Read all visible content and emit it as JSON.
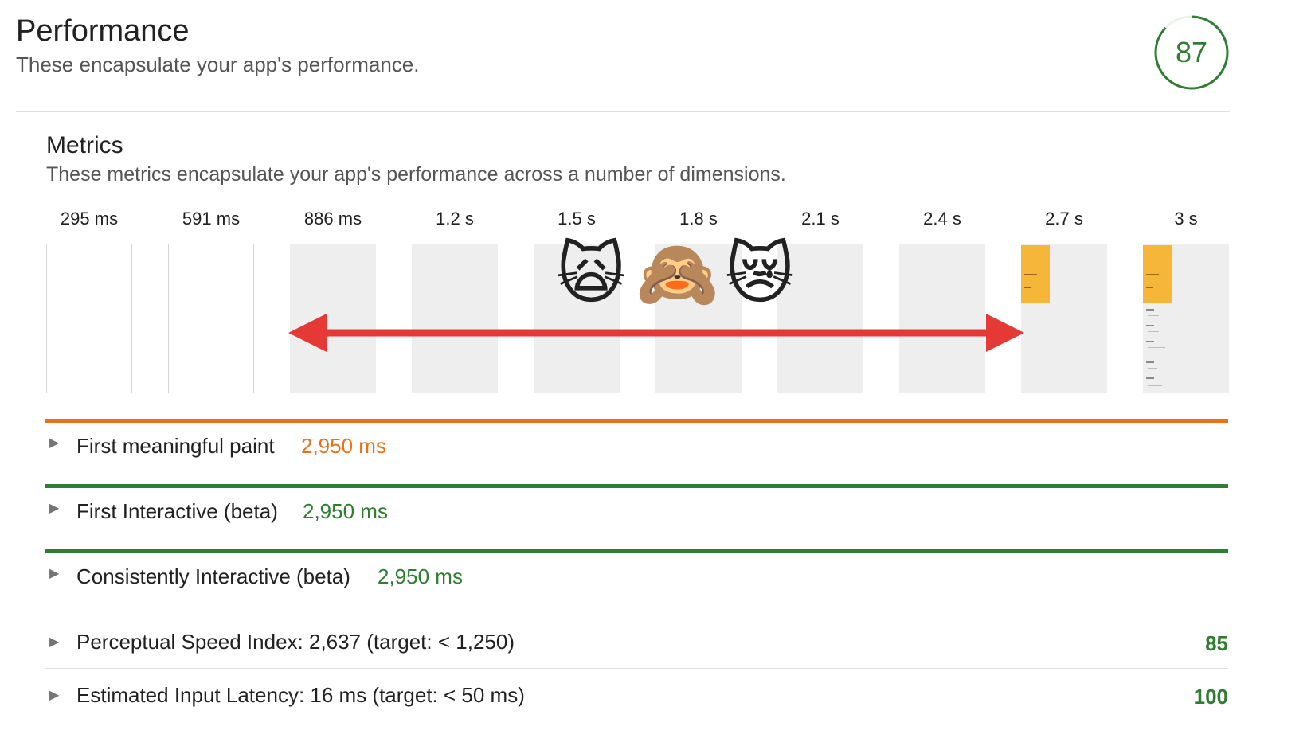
{
  "header": {
    "title": "Performance",
    "subtitle": "These encapsulate your app's performance.",
    "score": "87",
    "score_color": "#2e7d32"
  },
  "metrics_section": {
    "heading": "Metrics",
    "description": "These metrics encapsulate your app's performance across a number of dimensions."
  },
  "filmstrip": {
    "labels": [
      "295 ms",
      "591 ms",
      "886 ms",
      "1.2 s",
      "1.5 s",
      "1.8 s",
      "2.1 s",
      "2.4 s",
      "2.7 s",
      "3 s"
    ]
  },
  "overlay": {
    "emojis": [
      "🙀",
      "🙈",
      "😿"
    ],
    "arrow_color": "#e53935"
  },
  "metrics": [
    {
      "label": "First meaningful paint",
      "value": "2,950 ms",
      "status_color": "#e8711a"
    },
    {
      "label": "First Interactive (beta)",
      "value": "2,950 ms",
      "status_color": "#2e7d32"
    },
    {
      "label": "Consistently Interactive (beta)",
      "value": "2,950 ms",
      "status_color": "#2e7d32"
    },
    {
      "label": "Perceptual Speed Index: 2,637 (target: < 1,250)",
      "score": "85"
    },
    {
      "label": "Estimated Input Latency: 16 ms (target: < 50 ms)",
      "score": "100"
    }
  ],
  "icons": {
    "disclosure": "disclosure-triangle-icon"
  }
}
